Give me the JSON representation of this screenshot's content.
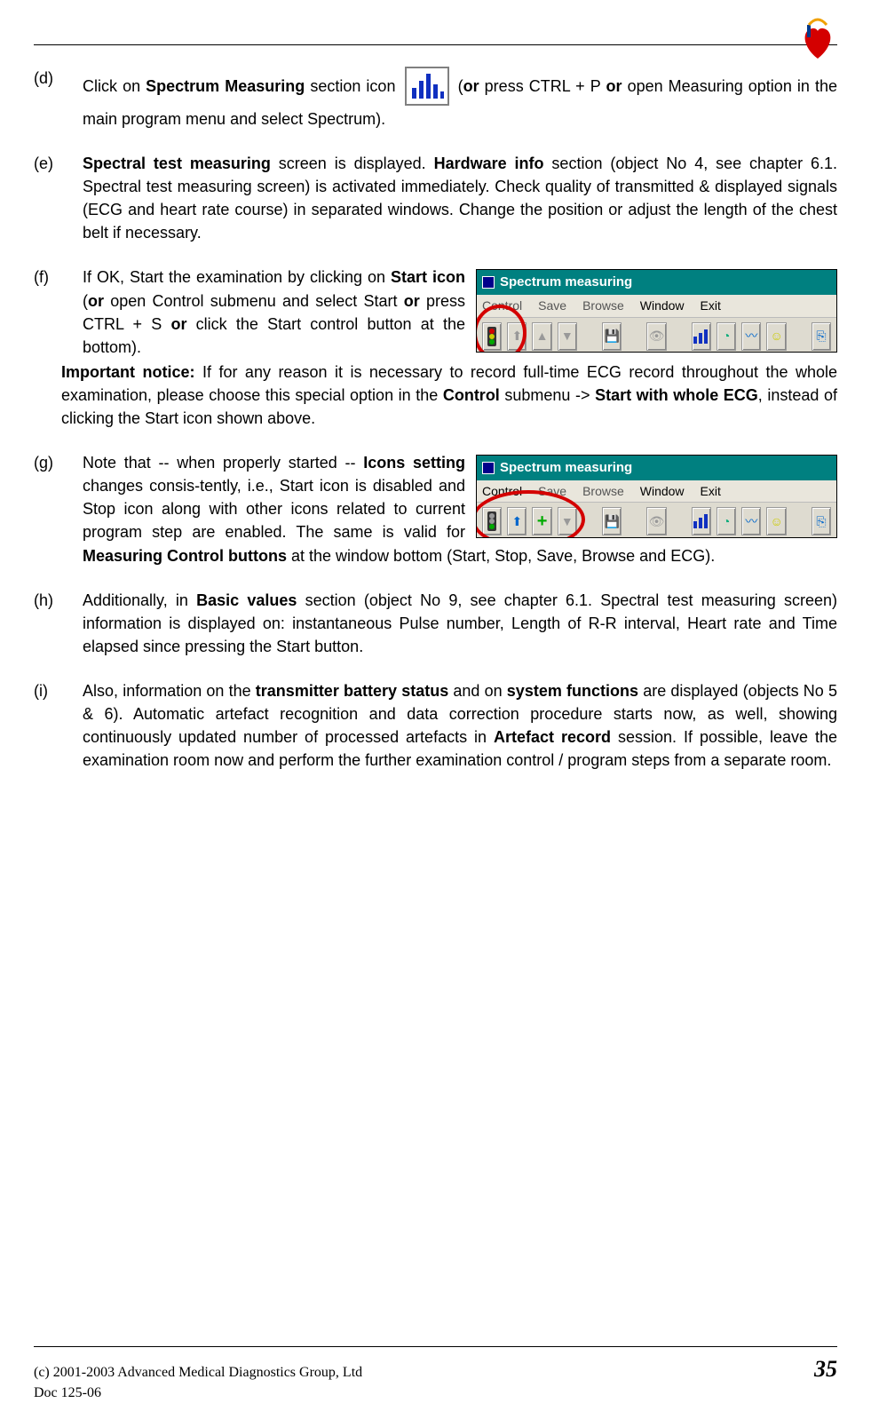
{
  "logo_label": "brand logo",
  "items": {
    "d": {
      "marker": "(d)",
      "pre": "Click on ",
      "bold1": "Spectrum Measuring",
      "mid1": " section icon ",
      "mid2": " (",
      "or1": "or",
      "mid3": " press CTRL + P ",
      "or2": "or",
      "mid4": " open  Measuring option in the main program menu and select Spectrum)."
    },
    "e": {
      "marker": "(e)",
      "bold1": "Spectral test measuring",
      "mid1": " screen is displayed. ",
      "bold2": "Hardware info",
      "mid2": " section (object No 4, see chapter 6.1. Spectral test measuring screen) is activated immediately. Check quality of transmitted & displayed signals (ECG and heart rate course) in separated windows. Change the position or adjust the length of the chest belt if necessary."
    },
    "f": {
      "marker": "(f)",
      "pre": "If OK, Start the examination by clicking on ",
      "bold1": "Start icon",
      "mid1": " (",
      "or1": "or",
      "mid2": " open Control submenu and select Start ",
      "or2": "or",
      "mid3": " press CTRL + S ",
      "or3": "or",
      "mid4": " click the Start control button at the bottom)."
    },
    "notice": {
      "bold1": "Important notice:",
      "mid1": " If for any reason it is necessary to record full-time ECG record throughout the whole examination, please choose this special option in the ",
      "bold2": "Control",
      "mid2": " submenu -> ",
      "bold3": "Start with whole ECG",
      "mid3": ", instead of clicking the Start icon shown above."
    },
    "g": {
      "marker": "(g)",
      "pre": "Note that -- when properly started -- ",
      "bold1": "Icons setting",
      "mid1": " changes  consis-tently, i.e., Start icon is disabled and Stop icon along with  other icons related to current program step are enabled. The same is valid for ",
      "bold2": "Measuring Control buttons",
      "mid2": " at the window bottom (Start, Stop, Save, Browse and ECG)."
    },
    "h": {
      "marker": "(h)",
      "pre": "Additionally, in ",
      "bold1": "Basic values",
      "mid1": " section (object No 9, see chapter 6.1. Spectral test measuring screen) information is displayed on: instantaneous Pulse number, Length of R-R interval, Heart rate and Time elapsed since pressing the Start button."
    },
    "i": {
      "marker": "(i)",
      "pre": "Also, information on the ",
      "bold1": "transmitter battery status",
      "mid1": " and on ",
      "bold2": "system functions",
      "mid2": " are displayed (objects No 5 & 6). Automatic artefact recognition and data correction procedure starts now, as well, showing continuously updated number of processed artefacts in ",
      "bold3": "Artefact record",
      "mid3": " session. If possible, leave the examination room now and perform the further examination control / program steps from a separate room."
    }
  },
  "toolbar": {
    "title": "Spectrum measuring",
    "menus": {
      "m1": "Control",
      "m2": "Save",
      "m3": "Browse",
      "m4": "Window",
      "m5": "Exit"
    }
  },
  "footer": {
    "copyright": "(c) 2001-2003 Advanced Medical Diagnostics Group, Ltd",
    "doc": "Doc 125-06",
    "page": "35"
  }
}
